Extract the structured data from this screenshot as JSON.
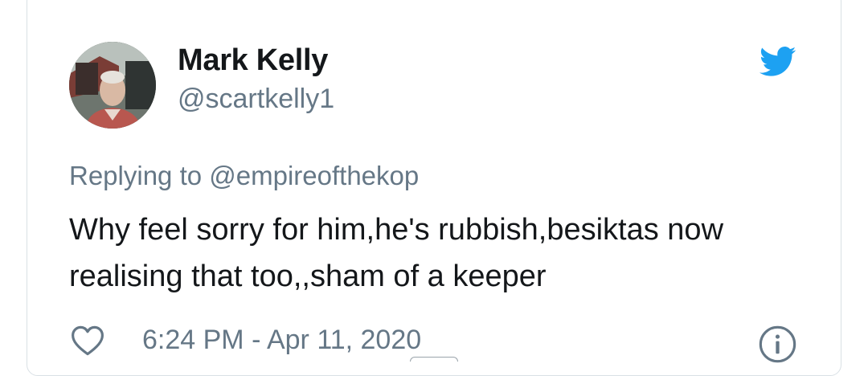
{
  "tweet": {
    "author": {
      "name": "Mark Kelly",
      "handle": "@scartkelly1"
    },
    "replying_to": "Replying to @empireofthekop",
    "text": "Why feel sorry for him,he's rubbish,besiktas now realising that too,,sham of a keeper",
    "timestamp": "6:24 PM - Apr 11, 2020"
  },
  "icons": {
    "brand": "twitter-bird-icon",
    "like": "heart-icon",
    "info": "info-icon"
  },
  "colors": {
    "brand": "#1da1f2",
    "primary_text": "#14171a",
    "secondary_text": "#657786",
    "border": "#d9e0e5"
  }
}
